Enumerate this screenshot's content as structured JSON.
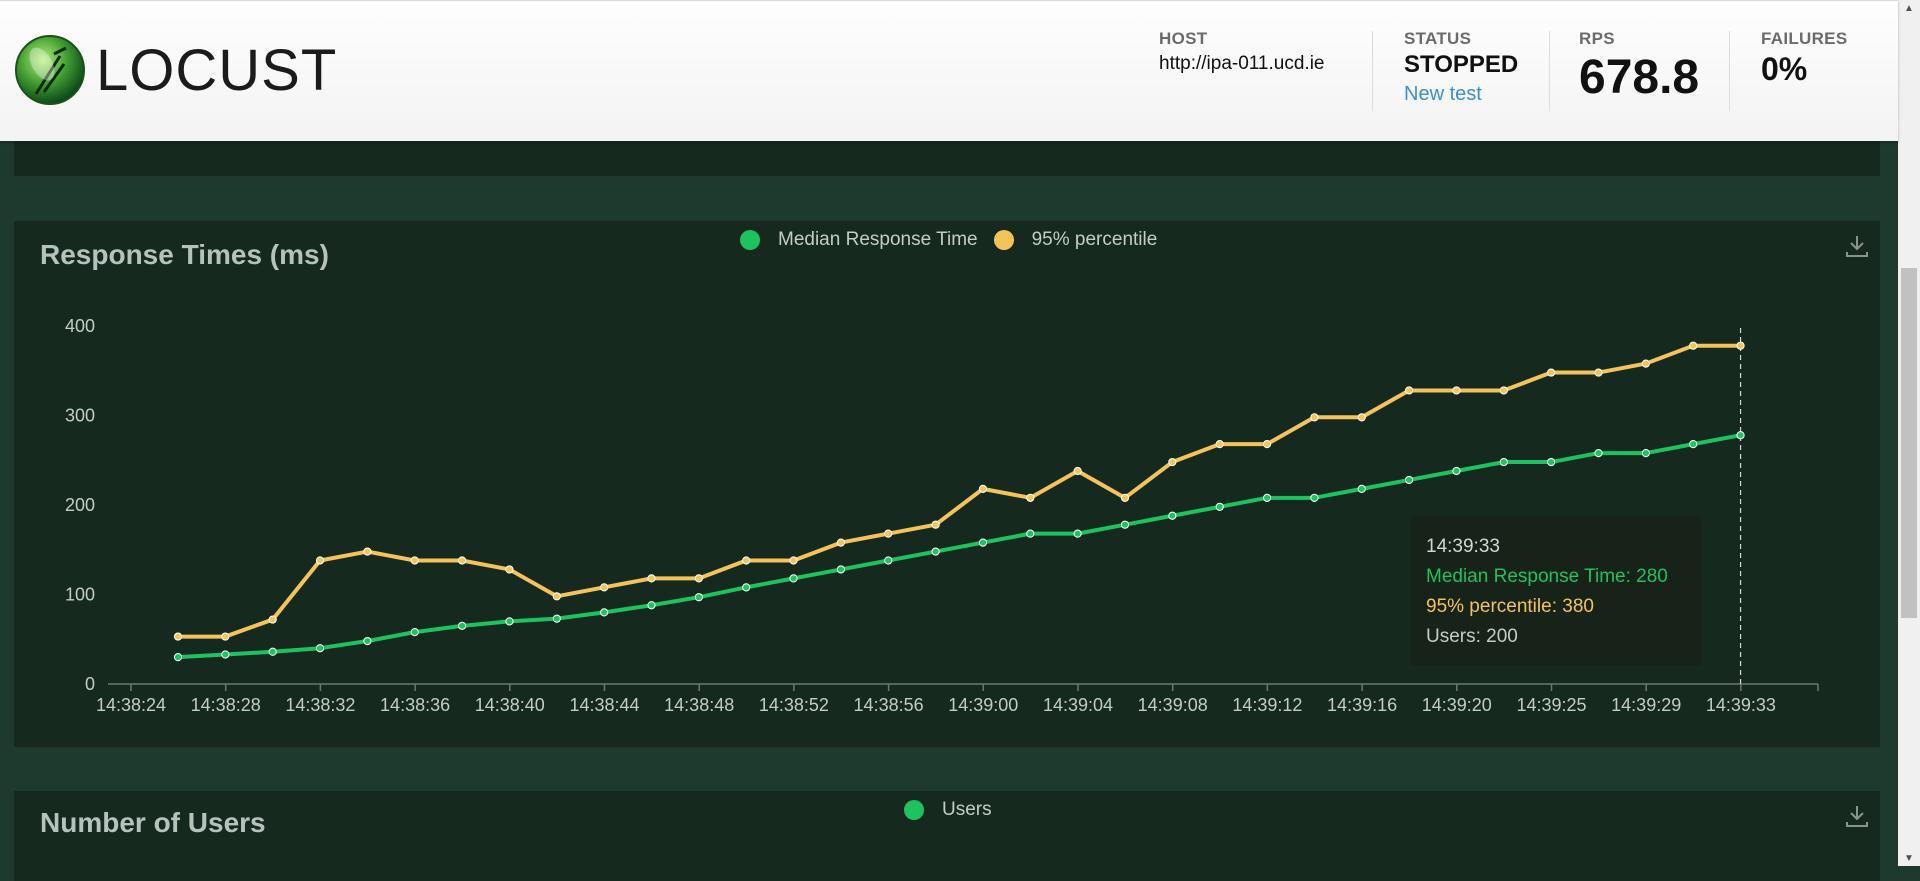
{
  "header": {
    "logo_text": "LOCUST",
    "host_label": "HOST",
    "host_value": "http://ipa-011.ucd.ie",
    "status_label": "STATUS",
    "status_value": "STOPPED",
    "new_test_label": "New test",
    "rps_label": "RPS",
    "rps_value": "678.8",
    "failures_label": "FAILURES",
    "failures_value": "0%"
  },
  "response_panel": {
    "title": "Response Times (ms)",
    "legend": [
      "Median Response Time",
      "95% percentile"
    ],
    "download_icon": "download-icon"
  },
  "users_panel": {
    "title": "Number of Users",
    "legend": [
      "Users"
    ],
    "download_icon": "download-icon"
  },
  "tooltip": {
    "time": "14:39:33",
    "median": "Median Response Time: 280",
    "p95": "95% percentile: 380",
    "users": "Users: 200"
  },
  "colors": {
    "median": "#1ec35f",
    "p95": "#f4c45a",
    "panel_bg": "#16291f",
    "page_bg": "#1e3a2e"
  },
  "chart_data": {
    "type": "line",
    "title": "Response Times (ms)",
    "xlabel": "",
    "ylabel": "",
    "ylim": [
      0,
      400
    ],
    "yticks": [
      0,
      100,
      200,
      300,
      400
    ],
    "xticks": [
      "14:38:24",
      "14:38:28",
      "14:38:32",
      "14:38:36",
      "14:38:40",
      "14:38:44",
      "14:38:48",
      "14:38:52",
      "14:38:56",
      "14:39:00",
      "14:39:04",
      "14:39:08",
      "14:39:12",
      "14:39:16",
      "14:39:20",
      "14:39:25",
      "14:39:29",
      "14:39:33"
    ],
    "legend_position": "top-center",
    "grid": false,
    "series": [
      {
        "name": "Median Response Time",
        "color": "#1ec35f",
        "values": [
          30,
          33,
          36,
          40,
          48,
          58,
          65,
          70,
          73,
          80,
          88,
          97,
          108,
          118,
          128,
          138,
          148,
          158,
          168,
          168,
          178,
          188,
          198,
          208,
          208,
          218,
          228,
          238,
          248,
          248,
          258,
          258,
          268,
          278
        ]
      },
      {
        "name": "95% percentile",
        "color": "#f4c45a",
        "values": [
          53,
          53,
          72,
          138,
          148,
          138,
          138,
          128,
          98,
          108,
          118,
          118,
          138,
          138,
          158,
          168,
          178,
          218,
          208,
          238,
          208,
          248,
          268,
          268,
          298,
          298,
          328,
          328,
          328,
          348,
          348,
          358,
          378,
          378
        ]
      }
    ],
    "hover_index": 33
  },
  "icons": {
    "scroll_up": "▲",
    "scroll_down": "▼"
  }
}
